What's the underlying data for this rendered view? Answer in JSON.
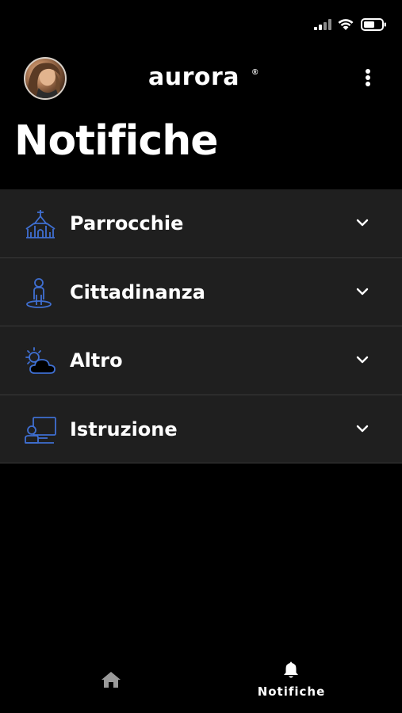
{
  "header": {
    "logo_text": "aurora",
    "logo_mark": "®",
    "avatar_icon": "user-avatar",
    "more_icon": "more-vertical-icon"
  },
  "page": {
    "title": "Notifiche"
  },
  "categories": [
    {
      "label": "Parrocchie",
      "icon": "church-icon"
    },
    {
      "label": "Cittadinanza",
      "icon": "citizen-icon"
    },
    {
      "label": "Altro",
      "icon": "weather-icon"
    },
    {
      "label": "Istruzione",
      "icon": "classroom-icon"
    }
  ],
  "bottom_nav": {
    "home_icon": "home-icon",
    "notifications_label": "Notifiche",
    "notifications_icon": "bell-icon"
  },
  "colors": {
    "background": "#000000",
    "list_background": "#1f1f1f",
    "divider": "#3a3a3a",
    "accent_icon": "#3f6fd1",
    "text": "#ffffff",
    "home_icon": "#9a9a9a"
  }
}
